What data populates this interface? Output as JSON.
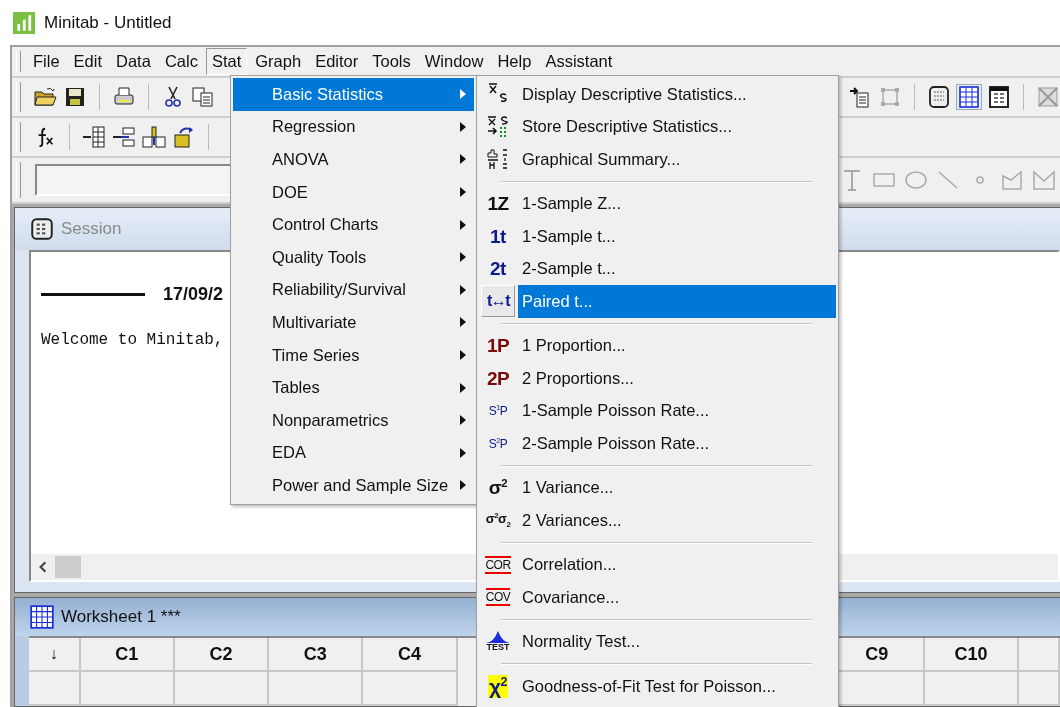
{
  "window": {
    "title": "Minitab - Untitled"
  },
  "menu_bar": [
    {
      "label": "File",
      "selected": false
    },
    {
      "label": "Edit",
      "selected": false
    },
    {
      "label": "Data",
      "selected": false
    },
    {
      "label": "Calc",
      "selected": false
    },
    {
      "label": "Stat",
      "selected": true
    },
    {
      "label": "Graph",
      "selected": false
    },
    {
      "label": "Editor",
      "selected": false
    },
    {
      "label": "Tools",
      "selected": false
    },
    {
      "label": "Window",
      "selected": false
    },
    {
      "label": "Help",
      "selected": false
    },
    {
      "label": "Assistant",
      "selected": false
    }
  ],
  "stat_menu": {
    "items": [
      {
        "label": "Basic Statistics",
        "submenu": true,
        "selected": true
      },
      {
        "label": "Regression",
        "submenu": true,
        "selected": false
      },
      {
        "label": "ANOVA",
        "submenu": true,
        "selected": false
      },
      {
        "label": "DOE",
        "submenu": true,
        "selected": false
      },
      {
        "label": "Control Charts",
        "submenu": true,
        "selected": false
      },
      {
        "label": "Quality Tools",
        "submenu": true,
        "selected": false
      },
      {
        "label": "Reliability/Survival",
        "submenu": true,
        "selected": false
      },
      {
        "label": "Multivariate",
        "submenu": true,
        "selected": false
      },
      {
        "label": "Time Series",
        "submenu": true,
        "selected": false
      },
      {
        "label": "Tables",
        "submenu": true,
        "selected": false
      },
      {
        "label": "Nonparametrics",
        "submenu": true,
        "selected": false
      },
      {
        "label": "EDA",
        "submenu": true,
        "selected": false
      },
      {
        "label": "Power and Sample Size",
        "submenu": true,
        "selected": false
      }
    ]
  },
  "basic_statistics_menu": {
    "items": [
      {
        "kind": "item",
        "label": "Display Descriptive Statistics...",
        "selected": false,
        "icon": {
          "kind": "xbar-s"
        }
      },
      {
        "kind": "item",
        "label": "Store Descriptive Statistics...",
        "selected": false,
        "icon": {
          "kind": "xbar-store"
        }
      },
      {
        "kind": "item",
        "label": "Graphical Summary...",
        "selected": false,
        "icon": {
          "kind": "summary"
        }
      },
      {
        "kind": "separator"
      },
      {
        "kind": "item",
        "label": "1-Sample Z...",
        "selected": false,
        "icon": {
          "kind": "glyph",
          "text": "1Z",
          "color": "#111111"
        }
      },
      {
        "kind": "item",
        "label": "1-Sample t...",
        "selected": false,
        "icon": {
          "kind": "glyph",
          "text": "1t",
          "color": "#0b1a8c"
        }
      },
      {
        "kind": "item",
        "label": "2-Sample t...",
        "selected": false,
        "icon": {
          "kind": "glyph",
          "text": "2t",
          "color": "#0b1a8c"
        }
      },
      {
        "kind": "item",
        "label": "Paired t...",
        "selected": true,
        "icon": {
          "kind": "glyph-narrow",
          "text": "t↔t",
          "color": "#0b1a8c"
        }
      },
      {
        "kind": "separator"
      },
      {
        "kind": "item",
        "label": "1 Proportion...",
        "selected": false,
        "icon": {
          "kind": "glyph",
          "text": "1P",
          "color": "#7a0a0a"
        }
      },
      {
        "kind": "item",
        "label": "2 Proportions...",
        "selected": false,
        "icon": {
          "kind": "glyph",
          "text": "2P",
          "color": "#7a0a0a"
        }
      },
      {
        "kind": "item",
        "label": "1-Sample Poisson Rate...",
        "selected": false,
        "icon": {
          "kind": "glyph-small",
          "text": "S$^{1}$P",
          "color": "#0b1a8c"
        }
      },
      {
        "kind": "item",
        "label": "2-Sample Poisson Rate...",
        "selected": false,
        "icon": {
          "kind": "glyph-small",
          "text": "S$^{2}$P",
          "color": "#0b1a8c"
        }
      },
      {
        "kind": "separator"
      },
      {
        "kind": "item",
        "label": "1 Variance...",
        "selected": false,
        "icon": {
          "kind": "glyph",
          "text": "σ$^{2}$",
          "color": "#111111"
        }
      },
      {
        "kind": "item",
        "label": "2 Variances...",
        "selected": false,
        "icon": {
          "kind": "glyph-heavy",
          "text": "σ$^{2}$σ$_{2}$",
          "color": "#111111"
        }
      },
      {
        "kind": "separator"
      },
      {
        "kind": "item",
        "label": "Correlation...",
        "selected": false,
        "icon": {
          "kind": "boxed",
          "text": "COR",
          "color": "#111111"
        }
      },
      {
        "kind": "item",
        "label": "Covariance...",
        "selected": false,
        "icon": {
          "kind": "boxed",
          "text": "COV",
          "color": "#111111"
        }
      },
      {
        "kind": "separator"
      },
      {
        "kind": "item",
        "label": "Normality Test...",
        "selected": false,
        "icon": {
          "kind": "test",
          "text": "TEST",
          "color": "#111111"
        }
      },
      {
        "kind": "separator"
      },
      {
        "kind": "item",
        "label": "Goodness-of-Fit Test for Poisson...",
        "selected": false,
        "icon": {
          "kind": "glyph-marked",
          "text": "χ$^{2}$"
        }
      }
    ]
  },
  "session": {
    "title": "Session",
    "date": "17/09/2",
    "text": "Welcome to Minitab,"
  },
  "worksheet": {
    "title": "Worksheet 1 ***",
    "columns": [
      "↓",
      "C1",
      "C2",
      "C3",
      "C4",
      "C9",
      "C10"
    ]
  }
}
